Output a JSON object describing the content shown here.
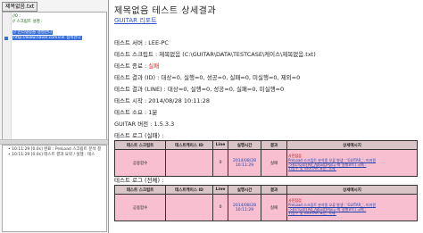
{
  "left": {
    "tab_label": "제목없음.txt",
    "editor_lines": [
      "//0 :",
      "// 스크립트 설명 :",
      "// 인터넷창을 생성한다",
      "http://www.naver.com으로 접속한다"
    ],
    "log_lines": [
      "• 10:11:29 [0.0s] 완료 : PreLoad 스크립트 분석 결",
      "• 10:11:29 [0.0s] 테스트 결과 요약 / 실행 : 테스"
    ]
  },
  "report": {
    "title": "제목없음 테스트 상세결과",
    "report_link": "GUITAR 리포트",
    "info": {
      "server": "테스트 서버 : LEE-PC",
      "script": "테스트 스크립트 : 제목없음 (C:\\GUITAR\\DATA\\TESTCASE\\케이스\\제목없음.txt)",
      "status_label": "테스트 종료 : ",
      "status_value": "실패",
      "result_id": "테스트 결과 (ID) : 대상=0, 실행=0, 성공=0, 실패=0, 미실행=0, 제외=0",
      "result_line": "테스트 결과 (LINE) : 대상=0, 실행=0, 성공=0, 실패=0, 미실행=0",
      "start_time": "테스트 시작 : 2014/08/28 10:11:28",
      "duration": "테스트 소요 : 1분",
      "guitar_version": "GUITAR 버전 : 1.5.3.3"
    },
    "log_fail_title": "테스트 로그 (실패) :",
    "log_all_title": "테스트 로그 (전체) :",
    "table_headers": [
      "테스트 스크립트",
      "테스트케이스 ID",
      "Line",
      "실행시간",
      "결과",
      "상세메시지"
    ],
    "fail_row": {
      "script": "공용함수",
      "tcid": "",
      "line": "0",
      "time": "2014/08/28 10:11:29",
      "result": "실패",
      "detail_lines": [
        "사전점검",
        "PreLoad 스크립트 분석중 오류 발생 : 'GUITAR_', 미지원",
        "  ->Rs:\\GUITAR_Adjust(Pos=-파 실행코드) 국제 :",
        "1)함수 및 \\GUITAR 표준,  국제:"
      ]
    },
    "all_row": {
      "script": "공용함수",
      "tcid": "",
      "line": "0",
      "time": "2014/08/28 10:11:29",
      "result": "실패",
      "detail_lines": [
        "사전점검",
        "PreLoad 스크립트 분석중 오류 발생 : 'GUITAR_', 미지원",
        "  ->Rs:\\GUITAR_Adjust(Pos=-파 실행코드) 국제 :",
        "1)함수 및 \\GUITAR 표준,  국제:"
      ]
    }
  },
  "colors": {
    "row_fail": "#f7bfd0",
    "header": "#d9c4c8",
    "status_fail": "#dd2222",
    "link": "#3355cc"
  }
}
